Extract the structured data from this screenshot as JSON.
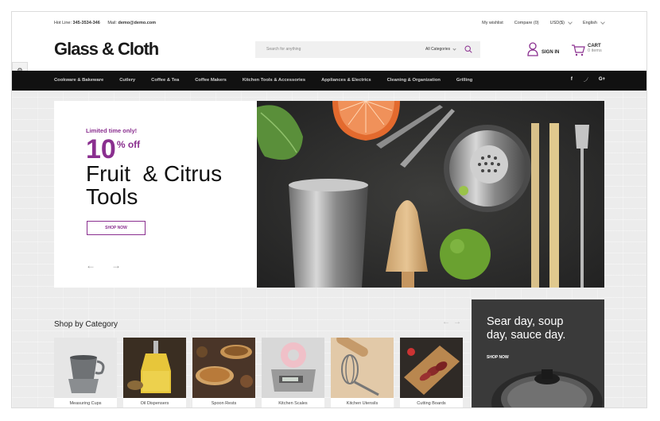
{
  "topbar": {
    "hotline_label": "Hot Line:",
    "hotline_value": "345-3534-346",
    "mail_label": "Mail:",
    "mail_value": "demo@demo.com",
    "wishlist": "My wishlist",
    "compare": "Compare (0)",
    "currency": "USD($)",
    "language": "English"
  },
  "header": {
    "logo": "Glass & Cloth",
    "search_placeholder": "Search for anything",
    "search_category": "All Categories",
    "signin": "SIGN IN",
    "cart_label": "CART",
    "cart_count": "0 items"
  },
  "nav": {
    "items": [
      "Cookware & Bakeware",
      "Cutlery",
      "Coffee & Tea",
      "Coffee Makers",
      "Kitchen Tools & Accessories",
      "Appliances & Electrics",
      "Cleaning & Organization",
      "Grilling"
    ],
    "social": [
      "f",
      "t",
      "G+"
    ]
  },
  "hero": {
    "limited": "Limited time only!",
    "discount_number": "10",
    "discount_suffix": "% off",
    "title_line1": "Fruit  & Citrus",
    "title_line2": "Tools",
    "shop_now": "SHOP NOW",
    "prev": "←",
    "next": "→"
  },
  "category": {
    "title": "Shop by Category",
    "prev": "←",
    "next": "→",
    "tiles": [
      "Measuring Cups",
      "Oil Dispensers",
      "Spoon Rests",
      "Kitchen Scales",
      "Kitchen Utensils",
      "Cutting Boards"
    ]
  },
  "promo": {
    "line1": "Sear day, soup",
    "line2": "day, sauce day.",
    "shop_now": "SHOP NOW"
  },
  "colors": {
    "accent": "#8a2f8f",
    "nav_bg": "#111111",
    "page_bg": "#ececec"
  }
}
